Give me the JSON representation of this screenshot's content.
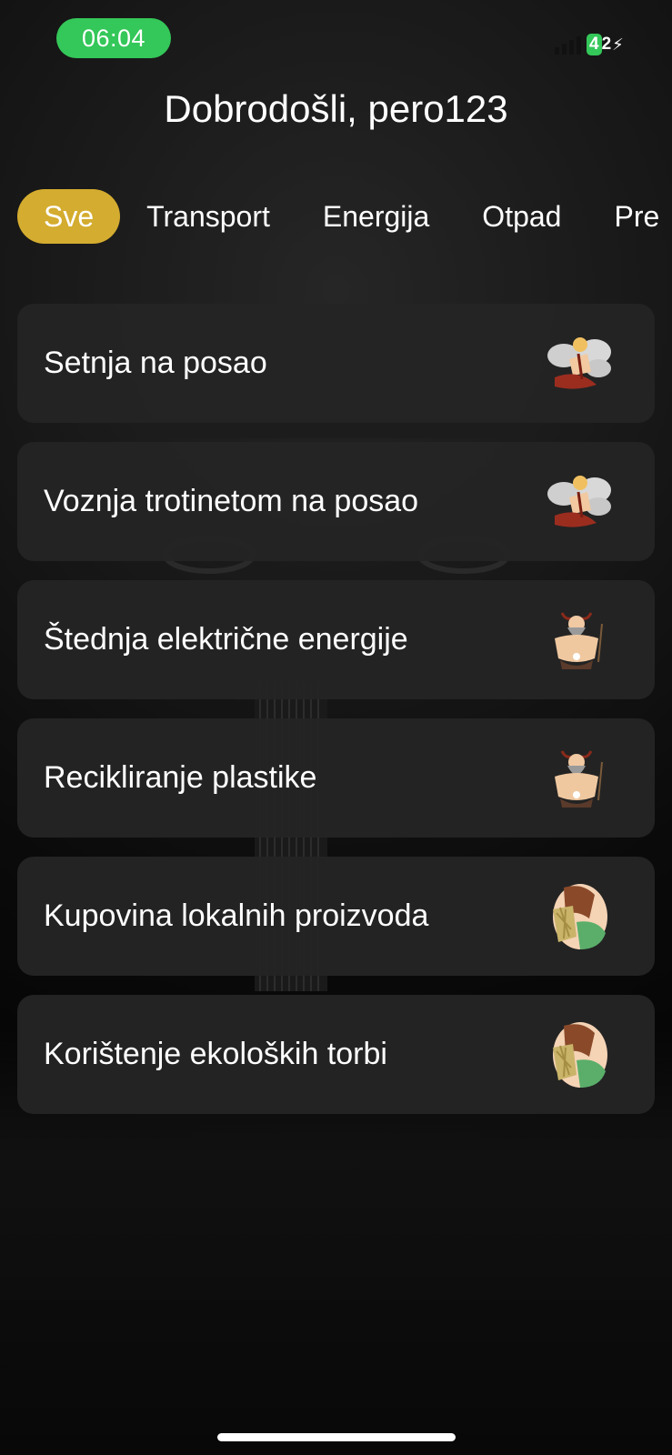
{
  "status_bar": {
    "time": "06:04",
    "battery_level": "42",
    "battery_level_shown_in_green": "4",
    "battery_level_rest": "2",
    "charging": true
  },
  "header": {
    "title": "Dobrodošli, pero123"
  },
  "tabs": [
    {
      "label": "Sve",
      "active": true
    },
    {
      "label": "Transport",
      "active": false
    },
    {
      "label": "Energija",
      "active": false
    },
    {
      "label": "Otpad",
      "active": false
    },
    {
      "label": "Pre",
      "active": false
    }
  ],
  "activities": [
    {
      "label": "Setnja na posao",
      "icon": "air-deity-icon"
    },
    {
      "label": "Voznja trotinetom na posao",
      "icon": "air-deity-icon"
    },
    {
      "label": "Štednja električne energije",
      "icon": "horned-god-icon"
    },
    {
      "label": "Recikliranje plastike",
      "icon": "horned-god-icon"
    },
    {
      "label": "Kupovina lokalnih proizvoda",
      "icon": "harvest-goddess-icon"
    },
    {
      "label": "Korištenje ekoloških torbi",
      "icon": "harvest-goddess-icon"
    }
  ],
  "colors": {
    "accent": "#d4ac2f",
    "status_green": "#34c759",
    "card_bg": "#242424"
  }
}
